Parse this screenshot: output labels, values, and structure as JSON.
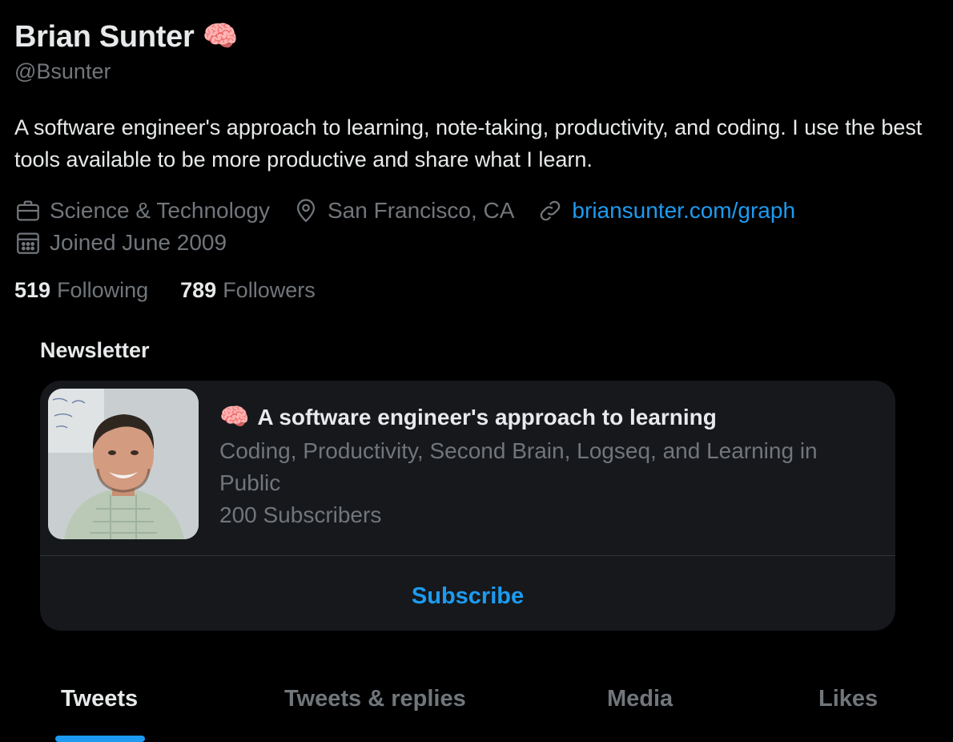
{
  "profile": {
    "name": "Brian Sunter",
    "name_emoji": "🧠",
    "handle": "@Bsunter",
    "bio": "A software engineer's approach to learning, note-taking, productivity, and coding. I use the best tools available to be more productive and share what I learn.",
    "category": "Science & Technology",
    "location": "San Francisco, CA",
    "website": "briansunter.com/graph",
    "joined": "Joined June 2009",
    "following_count": "519",
    "following_label": "Following",
    "followers_count": "789",
    "followers_label": "Followers"
  },
  "newsletter": {
    "heading": "Newsletter",
    "emoji": "🧠",
    "title": "A software engineer's approach to learning",
    "description": "Coding, Productivity, Second Brain, Logseq, and Learning in Public",
    "subscribers": "200 Subscribers",
    "subscribe_label": "Subscribe"
  },
  "tabs": [
    {
      "label": "Tweets",
      "active": true
    },
    {
      "label": "Tweets & replies",
      "active": false
    },
    {
      "label": "Media",
      "active": false
    },
    {
      "label": "Likes",
      "active": false
    }
  ],
  "colors": {
    "background": "#000000",
    "primary_text": "#e7e9ea",
    "secondary_text": "#71767b",
    "accent": "#1d9bf0",
    "card": "#16181c"
  },
  "icons": {
    "category": "briefcase-icon",
    "location": "location-pin-icon",
    "website": "link-icon",
    "joined": "calendar-icon"
  }
}
